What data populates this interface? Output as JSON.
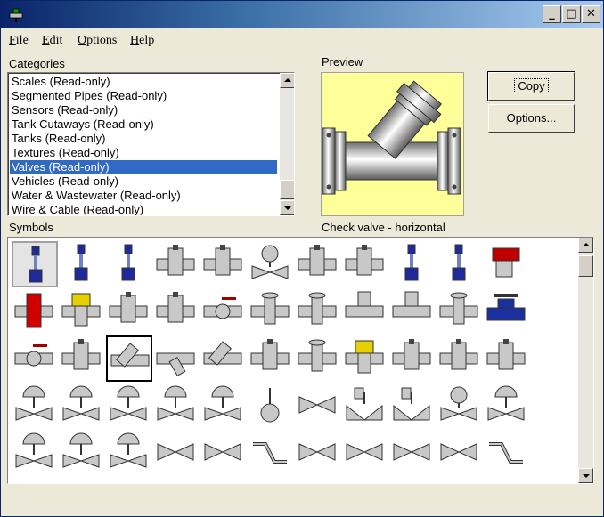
{
  "window": {
    "title": ""
  },
  "titlebar_buttons": {
    "minimize": "_",
    "maximize": "□",
    "close": "✕"
  },
  "menu": [
    {
      "label": "File",
      "key": "F",
      "rest": "ile"
    },
    {
      "label": "Edit",
      "key": "E",
      "rest": "dit"
    },
    {
      "label": "Options",
      "key": "O",
      "rest": "ptions"
    },
    {
      "label": "Help",
      "key": "H",
      "rest": "elp"
    }
  ],
  "categories": {
    "label": "Categories",
    "items": [
      "Scales (Read-only)",
      "Segmented Pipes (Read-only)",
      "Sensors (Read-only)",
      "Tank Cutaways (Read-only)",
      "Tanks (Read-only)",
      "Textures (Read-only)",
      "Valves (Read-only)",
      "Vehicles (Read-only)",
      "Water & Wastewater (Read-only)",
      "Wire & Cable (Read-only)"
    ],
    "selected_index": 6
  },
  "preview": {
    "label": "Preview",
    "caption": "Check valve - horizontal",
    "bg_color": "#ffff99"
  },
  "buttons": {
    "copy": "Copy",
    "options": "Options..."
  },
  "symbols": {
    "label": "Symbols",
    "selected_index": 24,
    "highlighted_index": 0,
    "items": [
      "actuator-valve-blue-icon",
      "actuator-valve-blue-icon",
      "actuator-valve-blue-icon",
      "control-valve-icon",
      "solenoid-valve-icon",
      "motor-valve-icon",
      "diaphragm-valve-icon",
      "control-valve-icon",
      "actuator-valve-blue-icon",
      "actuator-valve-blue-icon",
      "actuator-valve-red-icon",
      "red-valve-icon",
      "yellow-valve-icon",
      "gate-valve-icon",
      "actuator-valve-icon",
      "ball-valve-icon",
      "pipe-valve-icon",
      "pipe-valve-icon",
      "pipe-tee-icon",
      "pipe-tee-icon",
      "pipe-valve-icon",
      "blue-valve-icon",
      "ball-valve-icon",
      "gate-valve-icon",
      "check-valve-icon",
      "y-valve-icon",
      "check-valve-icon",
      "gauge-valve-icon",
      "pipe-valve-icon",
      "yellow-valve-icon",
      "angle-valve-icon",
      "small-valve-icon",
      "diaphragm-valve-icon",
      "dome-valve-icon",
      "dome-valve-icon",
      "dome-valve-icon",
      "dome-valve-icon",
      "dome-valve-icon",
      "ball-float-icon",
      "bowtie-valve-icon",
      "square-valve-icon",
      "square-valve-icon",
      "motor-valve-icon",
      "dome-valve-icon",
      "dome-valve-icon",
      "dome-valve-icon",
      "dome-valve-icon",
      "bowtie-valve-icon",
      "bowtie-valve-icon",
      "zigzag-icon",
      "bowtie-valve-icon",
      "bowtie-valve-icon",
      "bowtie-valve-icon",
      "bowtie-valve-icon",
      "zigzag-icon"
    ]
  }
}
